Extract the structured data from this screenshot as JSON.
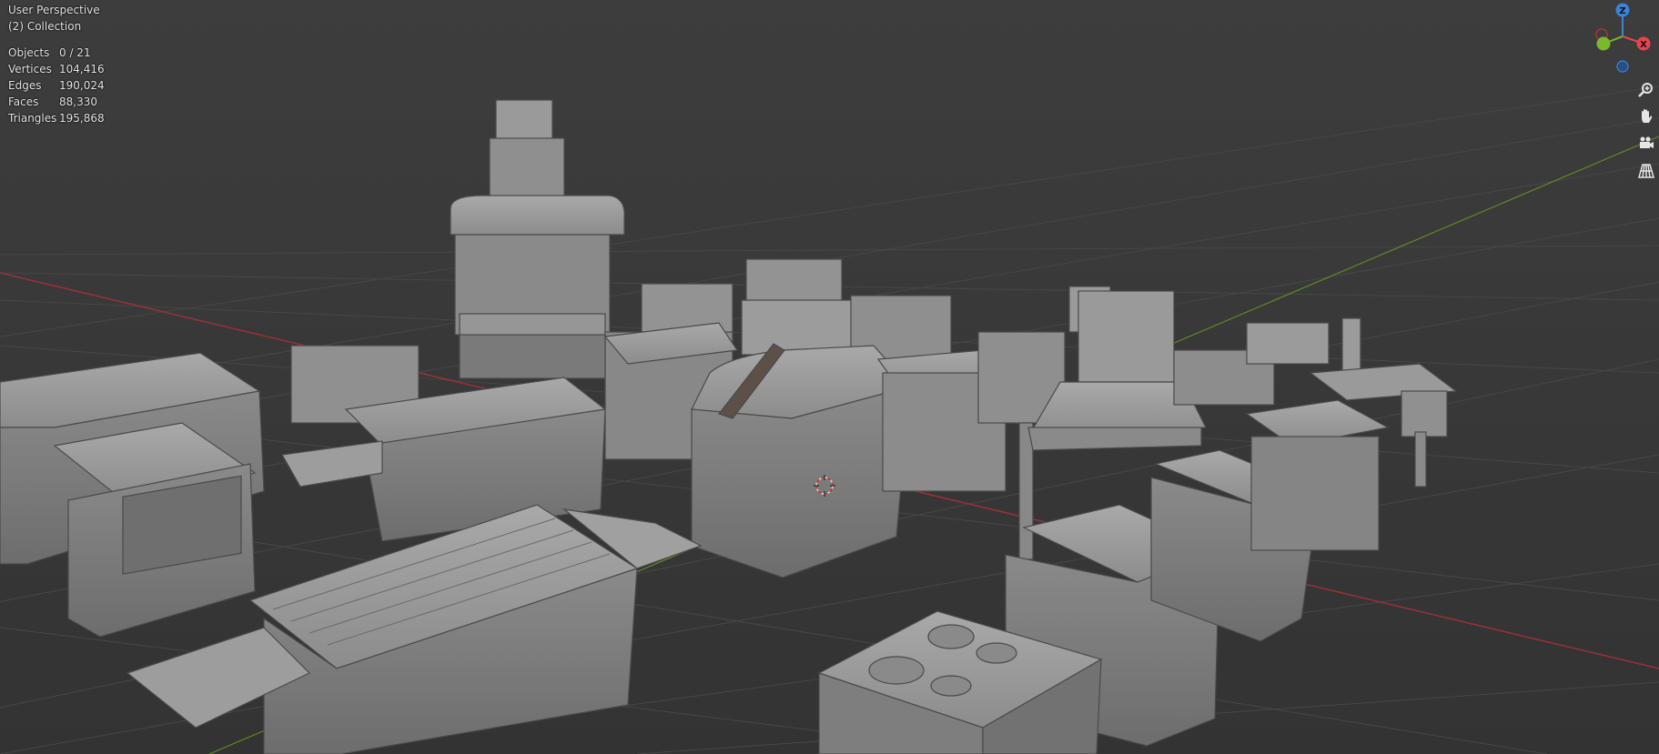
{
  "viewport": {
    "view_name": "User Perspective",
    "collection": "(2) Collection"
  },
  "stats": [
    {
      "label": "Objects",
      "value": "0 / 21"
    },
    {
      "label": "Vertices",
      "value": "104,416"
    },
    {
      "label": "Edges",
      "value": "190,024"
    },
    {
      "label": "Faces",
      "value": "88,330"
    },
    {
      "label": "Triangles",
      "value": "195,868"
    }
  ],
  "gizmo": {
    "z_label": "Z",
    "x_label": "X",
    "colors": {
      "x": "#e8434f",
      "y": "#7ab82c",
      "z": "#3b82d9"
    }
  },
  "tools": [
    "zoom-icon",
    "hand-icon",
    "camera-icon",
    "grid-icon"
  ],
  "colors": {
    "background": "#3a3a3a",
    "grid": "#4a4a4a",
    "x_axis": "#a8333a",
    "y_axis": "#6c8f2a",
    "model": "#8f8f8f"
  }
}
